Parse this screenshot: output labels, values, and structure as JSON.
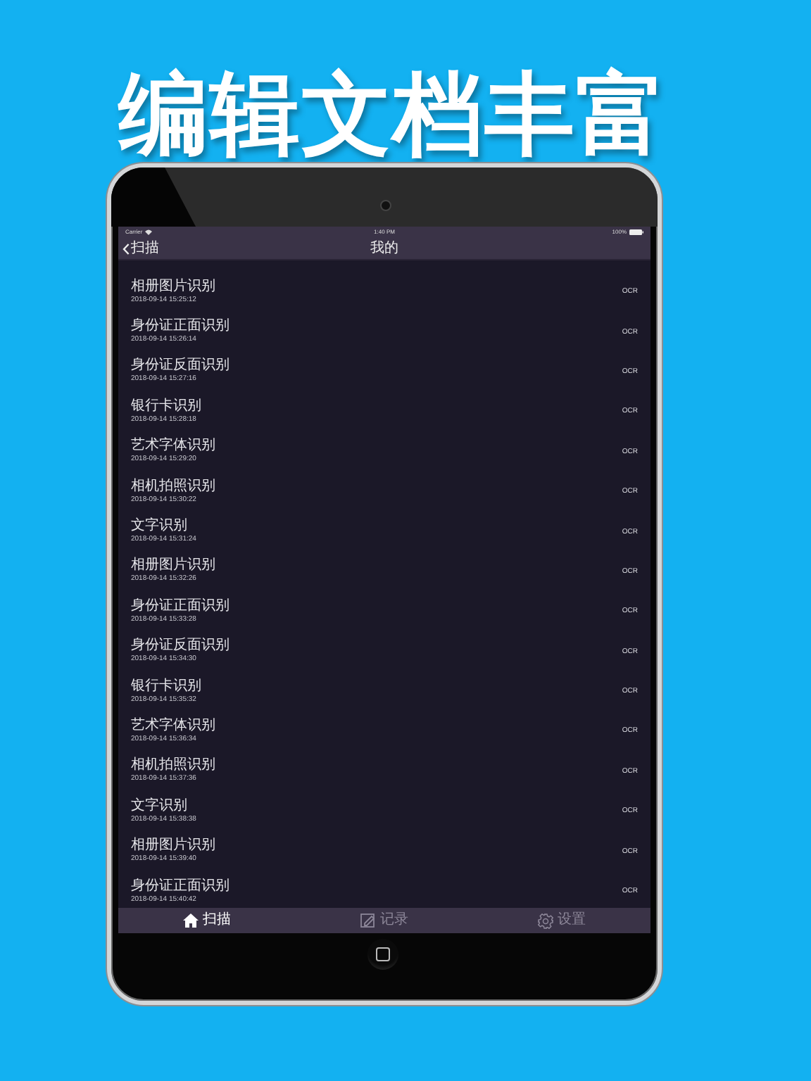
{
  "headline": "编辑文档丰富",
  "status_bar": {
    "carrier": "Carrier",
    "time": "1:40 PM",
    "battery": "100%"
  },
  "nav": {
    "back": "扫描",
    "title": "我的"
  },
  "records": [
    {
      "title": "相册图片识别",
      "time": "2018-09-14 15:25:12",
      "action": "OCR"
    },
    {
      "title": "身份证正面识别",
      "time": "2018-09-14 15:26:14",
      "action": "OCR"
    },
    {
      "title": "身份证反面识别",
      "time": "2018-09-14 15:27:16",
      "action": "OCR"
    },
    {
      "title": "银行卡识别",
      "time": "2018-09-14 15:28:18",
      "action": "OCR"
    },
    {
      "title": "艺术字体识别",
      "time": "2018-09-14 15:29:20",
      "action": "OCR"
    },
    {
      "title": "相机拍照识别",
      "time": "2018-09-14 15:30:22",
      "action": "OCR"
    },
    {
      "title": "文字识别",
      "time": "2018-09-14 15:31:24",
      "action": "OCR"
    },
    {
      "title": "相册图片识别",
      "time": "2018-09-14 15:32:26",
      "action": "OCR"
    },
    {
      "title": "身份证正面识别",
      "time": "2018-09-14 15:33:28",
      "action": "OCR"
    },
    {
      "title": "身份证反面识别",
      "time": "2018-09-14 15:34:30",
      "action": "OCR"
    },
    {
      "title": "银行卡识别",
      "time": "2018-09-14 15:35:32",
      "action": "OCR"
    },
    {
      "title": "艺术字体识别",
      "time": "2018-09-14 15:36:34",
      "action": "OCR"
    },
    {
      "title": "相机拍照识别",
      "time": "2018-09-14 15:37:36",
      "action": "OCR"
    },
    {
      "title": "文字识别",
      "time": "2018-09-14 15:38:38",
      "action": "OCR"
    },
    {
      "title": "相册图片识别",
      "time": "2018-09-14 15:39:40",
      "action": "OCR"
    },
    {
      "title": "身份证正面识别",
      "time": "2018-09-14 15:40:42",
      "action": "OCR"
    }
  ],
  "tab_bar": [
    {
      "kind": "home",
      "label": "扫描",
      "selected": true
    },
    {
      "kind": "edit",
      "label": "记录",
      "selected": false
    },
    {
      "kind": "gear",
      "label": "设置",
      "selected": false
    }
  ]
}
